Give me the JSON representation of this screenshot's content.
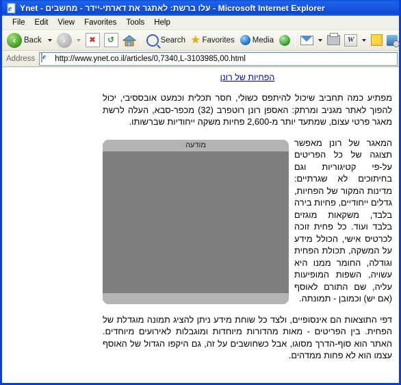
{
  "window": {
    "title": "Ynet - עלו ברשת: לאתגר את דארתי-יידר - מחשבים - Microsoft Internet Explorer",
    "icon": "ie-document-icon"
  },
  "menubar": {
    "items": [
      {
        "label": "File"
      },
      {
        "label": "Edit"
      },
      {
        "label": "View"
      },
      {
        "label": "Favorites"
      },
      {
        "label": "Tools"
      },
      {
        "label": "Help"
      }
    ]
  },
  "toolbar": {
    "back_label": "Back",
    "forward_label": "",
    "stop_label": "",
    "refresh_label": "",
    "home_label": "",
    "search_label": "Search",
    "favorites_label": "Favorites",
    "media_label": "Media",
    "history_label": "",
    "mail_label": "",
    "print_label": "",
    "edit_word_label": "W",
    "notes_label": "",
    "messenger_label": ""
  },
  "address": {
    "label": "Address",
    "url": "http://www.ynet.co.il/articles/0,7340,L-3103985,00.html",
    "placeholder": "http://www.ynet.co.il/articles/0,7340,L-3103985,00.html"
  },
  "page": {
    "top_link": "הפחיות של רונן",
    "paragraph_1": "מפתיע כמה תחביב שיכול להיתפס כשולי, חסר תכלית וכמעט אובססיבי, יכול להפוך לאתר מגניב ומרתק: האספן רונן רוטפרב (32) מכפר-סבא, העלה לרשת מאגר פרטי עצום, שמתעד יותר מ-2,600 פחיות משקה ייחודיות שברשותו.",
    "paragraph_2": "המאגר של רונן מאפשר תצוגה של כל הפריטים על-פי קטיגוריות וגם בחיתוכים לא שגרתיים: מדינות המקור של הפחיות, גדלים ייחודיים, פחיות בירה בלבד, משקאות מוגזים בלבד ועוד. כל פחית זוכה לכרטיס אישי, הכולל מידע על המשקה, תכולת הפחית וגודלה, החומר ממנו היא עשויה, השפות המופיעות עליה, שם התורם לאוסף (אם יש) וכמובן - תמונתה.",
    "paragraph_3": "דפי התוצאות הם אינסופיים, ולצד כל שוחת מידע ניתן להציג תמונה מוגדלת של הפחית. בין הפריטים - מאות מהדורות מיוחדות ומוגבלות לאירועים מיוחדים. האתר הוא סוף-הדרך מסוגו, אבל כשחושבים על זה, גם היקפו הגדול של האוסף עצמו הוא לא פחות ממדהים.",
    "ad": {
      "header_label": "מודעה"
    }
  }
}
